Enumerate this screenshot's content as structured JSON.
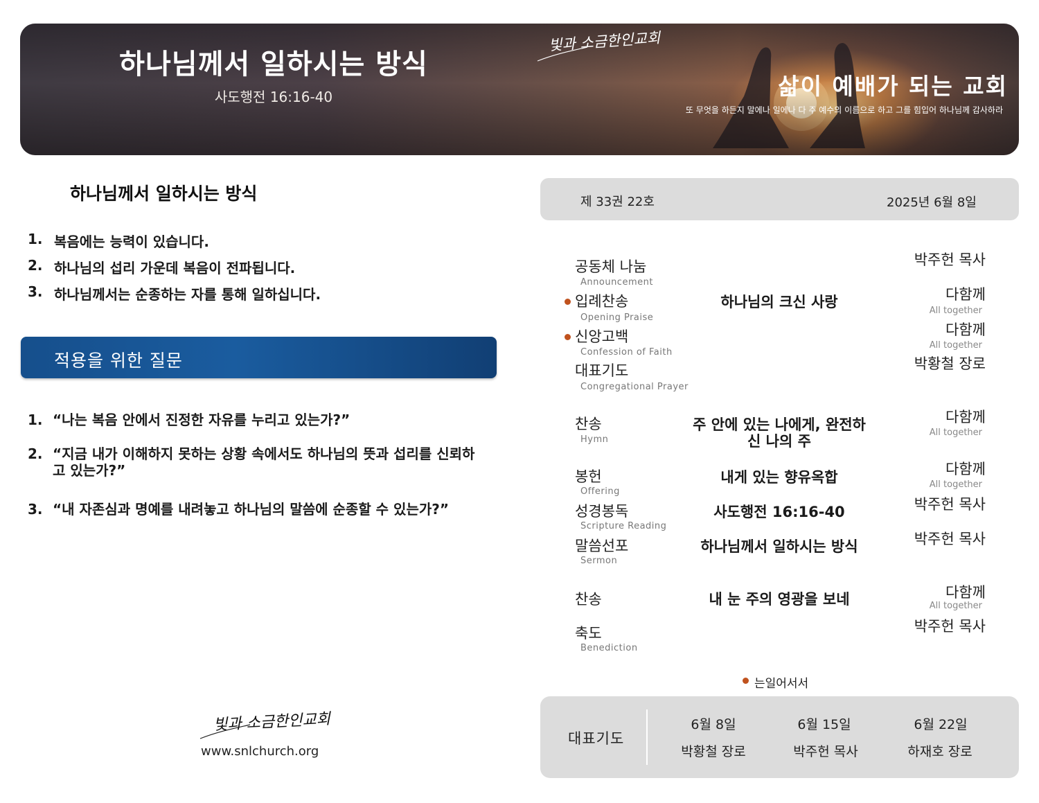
{
  "banner": {
    "title": "하나님께서 일하시는 방식",
    "reference": "사도행전 16:16-40",
    "logo": "빛과 소금한인교회",
    "slogan": "삶이 예배가 되는 교회",
    "verse": "또 무엇을 하든지 말에나 일에나 다 주 예수의 이름으로 하고 그를 힘입어 하나님께 감사하라"
  },
  "sermon": {
    "title": "하나님께서 일하시는 방식",
    "points": [
      {
        "num": "1.",
        "text": "복음에는 능력이 있습니다."
      },
      {
        "num": "2.",
        "text": "하나님의 섭리 가운데 복음이 전파됩니다."
      },
      {
        "num": "3.",
        "text": "하나님께서는 순종하는 자를 통해 일하십니다."
      }
    ]
  },
  "application": {
    "heading": "적용을 위한 질문",
    "questions": [
      {
        "num": "1.",
        "text": "“나는 복음 안에서 진정한 자유를 누리고 있는가?”"
      },
      {
        "num": "2.",
        "text": "“지금 내가 이해하지 못하는 상황 속에서도 하나님의 뜻과 섭리를 신뢰하고 있는가?”"
      },
      {
        "num": "3.",
        "text": "“내 자존심과 명예를 내려놓고 하나님의 말씀에 순종할 수 있는가?”"
      }
    ]
  },
  "footer": {
    "logo": "빛과 소금한인교회",
    "url": "www.snlchurch.org"
  },
  "issue": {
    "number": "제 33권 22호",
    "date": "2025년 6월 8일"
  },
  "order": [
    {
      "label": "공동체 나눔",
      "sub": "Announcement",
      "middle": "",
      "leader": "박주헌 목사",
      "leader_sub": "",
      "standing": false
    },
    {
      "label": "입례찬송",
      "sub": "Opening Praise",
      "middle": "하나님의 크신 사랑",
      "leader": "다함께",
      "leader_sub": "All together",
      "standing": true
    },
    {
      "label": "신앙고백",
      "sub": "Confession of Faith",
      "middle": "",
      "leader": "다함께",
      "leader_sub": "All together",
      "standing": true
    },
    {
      "label": "대표기도",
      "sub": "Congregational Prayer",
      "middle": "",
      "leader": "박황철 장로",
      "leader_sub": "",
      "standing": false
    },
    {
      "label": "찬송",
      "sub": "Hymn",
      "middle": "주 안에 있는 나에게, 완전하신 나의 주",
      "leader": "다함께",
      "leader_sub": "All together",
      "standing": false
    },
    {
      "label": "봉헌",
      "sub": "Offering",
      "middle": "내게 있는 향유옥합",
      "leader": "다함께",
      "leader_sub": "All together",
      "standing": false
    },
    {
      "label": "성경봉독",
      "sub": "Scripture Reading",
      "middle": "사도행전 16:16-40",
      "leader": "박주헌 목사",
      "leader_sub": "",
      "standing": false
    },
    {
      "label": "말씀선포",
      "sub": "Sermon",
      "middle": "하나님께서 일하시는 방식",
      "leader": "박주헌 목사",
      "leader_sub": "",
      "standing": false
    },
    {
      "label": "찬송",
      "sub": "",
      "middle": "내 눈 주의 영광을 보네",
      "leader": "다함께",
      "leader_sub": "All together",
      "standing": false
    },
    {
      "label": "축도",
      "sub": "Benediction",
      "middle": "",
      "leader": "박주헌 목사",
      "leader_sub": "",
      "standing": false
    }
  ],
  "standing_note": "는일어서서",
  "prayer": {
    "label": "대표기도",
    "schedule": [
      {
        "date": "6월 8일",
        "name": "박황철 장로"
      },
      {
        "date": "6월 15일",
        "name": "박주헌 목사"
      },
      {
        "date": "6월 22일",
        "name": "하재호 장로"
      }
    ]
  },
  "colors": {
    "accent_blue": "#1a5c9f",
    "standing_dot": "#c0521e",
    "panel_gray": "#dcdcdc"
  }
}
